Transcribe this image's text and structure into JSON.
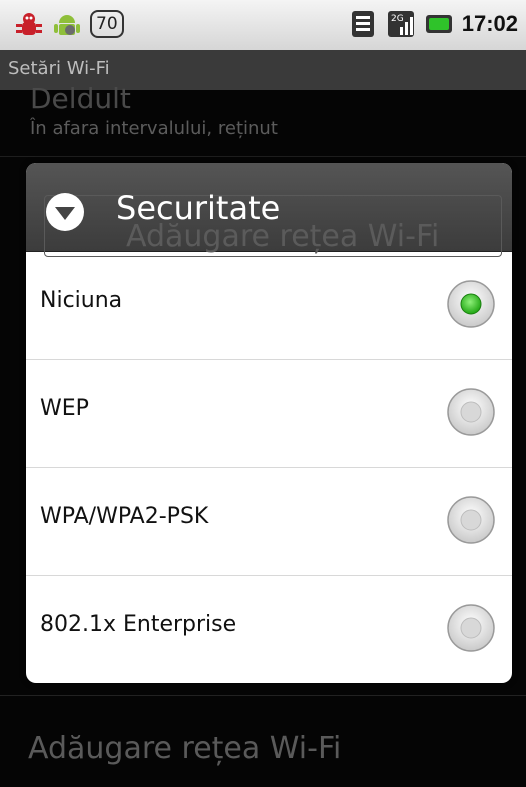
{
  "status_bar": {
    "notification_count": "70",
    "time": "17:02",
    "icons": [
      "bug-icon",
      "android-icon",
      "wifi-icon",
      "signal-2g-icon",
      "battery-icon"
    ]
  },
  "app": {
    "title": "Setări Wi-Fi"
  },
  "background": {
    "item_title": "Deldult",
    "item_summary": "În afara intervalului, reținut",
    "add_network": "Adăugare rețea Wi-Fi"
  },
  "dialog": {
    "title": "Securitate",
    "options": [
      {
        "label": "Niciuna",
        "selected": true
      },
      {
        "label": "WEP",
        "selected": false
      },
      {
        "label": "WPA/WPA2-PSK",
        "selected": false
      },
      {
        "label": "802.1x Enterprise",
        "selected": false
      }
    ]
  },
  "colors": {
    "radio_selected": "#35c21f",
    "dialog_header": "#474747",
    "status_bar": "#e6e6e6"
  }
}
